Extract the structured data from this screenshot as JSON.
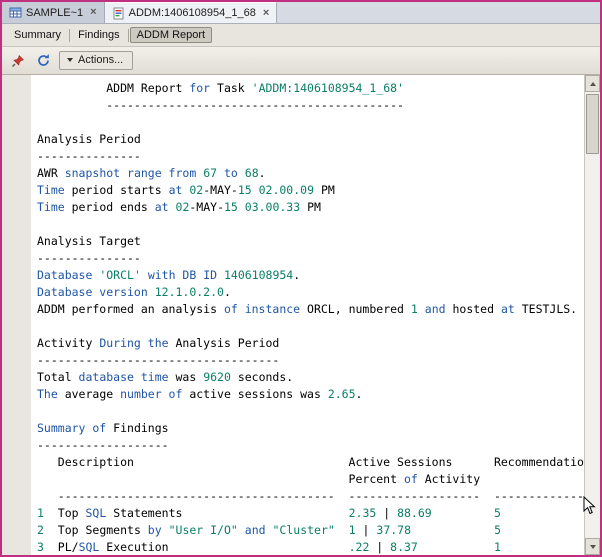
{
  "tabs": [
    {
      "label": "SAMPLE~1",
      "active": false
    },
    {
      "label": "ADDM:1406108954_1_68",
      "active": true
    }
  ],
  "subtabs": [
    {
      "label": "Summary",
      "active": false
    },
    {
      "label": "Findings",
      "active": false
    },
    {
      "label": "ADDM Report",
      "active": true
    }
  ],
  "toolbar": {
    "actions_label": "Actions..."
  },
  "icons": {
    "close_glyph": "×",
    "pin": "red-pushpin",
    "refresh": "blue-refresh-arrows",
    "actions_caret": "down-triangle",
    "scroll_up": "up-triangle",
    "scroll_down": "down-triangle"
  },
  "colors": {
    "frame": "#c03080",
    "keyword": "#1f55a5",
    "number": "#0a7e66"
  },
  "report": {
    "lines": [
      [
        [
          "p",
          "          ADDM Report "
        ],
        [
          "k",
          "for"
        ],
        [
          "p",
          " Task "
        ],
        [
          "n",
          "'ADDM:1406108954_1_68'"
        ]
      ],
      [
        [
          "p",
          "          -------------------------------------------"
        ]
      ],
      [],
      [
        [
          "p",
          "Analysis Period"
        ]
      ],
      [
        [
          "p",
          "---------------"
        ]
      ],
      [
        [
          "p",
          "AWR "
        ],
        [
          "k",
          "snapshot range from"
        ],
        [
          "p",
          " "
        ],
        [
          "n",
          "67"
        ],
        [
          "p",
          " "
        ],
        [
          "k",
          "to"
        ],
        [
          "p",
          " "
        ],
        [
          "n",
          "68"
        ],
        [
          "p",
          "."
        ]
      ],
      [
        [
          "k",
          "Time"
        ],
        [
          "p",
          " period starts "
        ],
        [
          "k",
          "at"
        ],
        [
          "p",
          " "
        ],
        [
          "n",
          "02"
        ],
        [
          "p",
          "-MAY-"
        ],
        [
          "n",
          "15 02.00.09"
        ],
        [
          "p",
          " PM"
        ]
      ],
      [
        [
          "k",
          "Time"
        ],
        [
          "p",
          " period ends "
        ],
        [
          "k",
          "at"
        ],
        [
          "p",
          " "
        ],
        [
          "n",
          "02"
        ],
        [
          "p",
          "-MAY-"
        ],
        [
          "n",
          "15 03.00.33"
        ],
        [
          "p",
          " PM"
        ]
      ],
      [],
      [
        [
          "p",
          "Analysis Target"
        ]
      ],
      [
        [
          "p",
          "---------------"
        ]
      ],
      [
        [
          "k",
          "Database"
        ],
        [
          "p",
          " "
        ],
        [
          "n",
          "'ORCL'"
        ],
        [
          "p",
          " "
        ],
        [
          "k",
          "with DB ID"
        ],
        [
          "p",
          " "
        ],
        [
          "n",
          "1406108954"
        ],
        [
          "p",
          "."
        ]
      ],
      [
        [
          "k",
          "Database version"
        ],
        [
          "p",
          " "
        ],
        [
          "n",
          "12.1.0.2.0"
        ],
        [
          "p",
          "."
        ]
      ],
      [
        [
          "p",
          "ADDM performed an analysis "
        ],
        [
          "k",
          "of instance"
        ],
        [
          "p",
          " ORCL, numbered "
        ],
        [
          "n",
          "1"
        ],
        [
          "p",
          " "
        ],
        [
          "k",
          "and"
        ],
        [
          "p",
          " hosted "
        ],
        [
          "k",
          "at"
        ],
        [
          "p",
          " TESTJLS."
        ]
      ],
      [],
      [
        [
          "p",
          "Activity "
        ],
        [
          "k",
          "During the"
        ],
        [
          "p",
          " Analysis Period"
        ]
      ],
      [
        [
          "p",
          "-----------------------------------"
        ]
      ],
      [
        [
          "p",
          "Total "
        ],
        [
          "k",
          "database time"
        ],
        [
          "p",
          " was "
        ],
        [
          "n",
          "9620"
        ],
        [
          "p",
          " seconds."
        ]
      ],
      [
        [
          "k",
          "The"
        ],
        [
          "p",
          " average "
        ],
        [
          "k",
          "number of"
        ],
        [
          "p",
          " active sessions was "
        ],
        [
          "n",
          "2.65"
        ],
        [
          "p",
          "."
        ]
      ],
      [],
      [
        [
          "k",
          "Summary of"
        ],
        [
          "p",
          " Findings"
        ]
      ],
      [
        [
          "p",
          "-------------------"
        ]
      ],
      [
        [
          "p",
          "   Description                               Active Sessions      Recommendations"
        ]
      ],
      [
        [
          "p",
          "                                             Percent "
        ],
        [
          "k",
          "of"
        ],
        [
          "p",
          " Activity"
        ]
      ],
      [
        [
          "p",
          "   ----------------------------------------  -------------------  ---------------"
        ]
      ],
      [
        [
          "n",
          "1"
        ],
        [
          "p",
          "  Top "
        ],
        [
          "k",
          "SQL"
        ],
        [
          "p",
          " Statements                        "
        ],
        [
          "n",
          "2.35"
        ],
        [
          "p",
          " | "
        ],
        [
          "n",
          "88.69"
        ],
        [
          "p",
          "         "
        ],
        [
          "n",
          "5"
        ]
      ],
      [
        [
          "n",
          "2"
        ],
        [
          "p",
          "  Top Segments "
        ],
        [
          "k",
          "by"
        ],
        [
          "p",
          " "
        ],
        [
          "n",
          "\"User I/O\""
        ],
        [
          "p",
          " "
        ],
        [
          "k",
          "and"
        ],
        [
          "p",
          " "
        ],
        [
          "n",
          "\"Cluster\""
        ],
        [
          "p",
          "  "
        ],
        [
          "n",
          "1"
        ],
        [
          "p",
          " | "
        ],
        [
          "n",
          "37.78"
        ],
        [
          "p",
          "            "
        ],
        [
          "n",
          "5"
        ]
      ],
      [
        [
          "n",
          "3"
        ],
        [
          "p",
          "  PL/"
        ],
        [
          "k",
          "SQL"
        ],
        [
          "p",
          " Execution                          "
        ],
        [
          "n",
          ".22"
        ],
        [
          "p",
          " | "
        ],
        [
          "n",
          "8.37"
        ],
        [
          "p",
          "           "
        ],
        [
          "n",
          "1"
        ]
      ]
    ]
  }
}
